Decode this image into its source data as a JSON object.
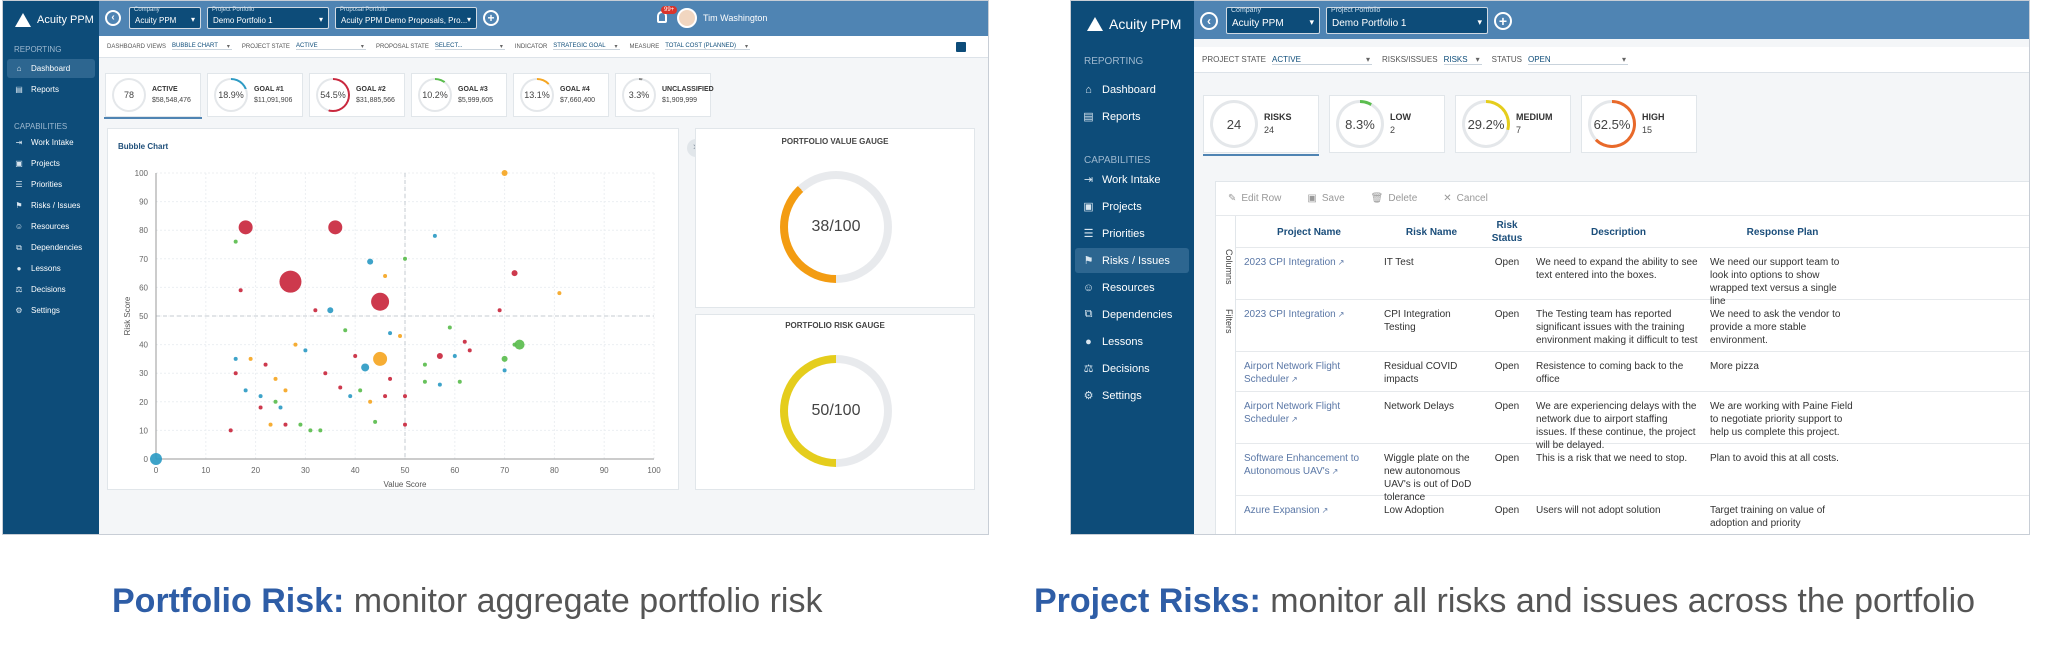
{
  "shotA": {
    "brand": "Acuity PPM",
    "company": {
      "label": "Company",
      "value": "Acuity PPM"
    },
    "project_portfolio": {
      "label": "Project Portfolio",
      "value": "Demo Portfolio 1"
    },
    "proposal_portfolio": {
      "label": "Proposal Portfolio",
      "value": "Acuity PPM Demo Proposals, Pro..."
    },
    "notif_count": "99+",
    "user": "Tim Washington",
    "nav_reporting": "REPORTING",
    "nav_capabilities": "CAPABILITIES",
    "nav": [
      {
        "label": "Dashboard",
        "icon": "home-icon"
      },
      {
        "label": "Reports",
        "icon": "report-icon"
      },
      {
        "label": "Work Intake",
        "icon": "intake-icon"
      },
      {
        "label": "Projects",
        "icon": "briefcase-icon"
      },
      {
        "label": "Priorities",
        "icon": "priorities-icon"
      },
      {
        "label": "Risks / Issues",
        "icon": "risk-icon"
      },
      {
        "label": "Resources",
        "icon": "people-icon"
      },
      {
        "label": "Dependencies",
        "icon": "dependencies-icon"
      },
      {
        "label": "Lessons",
        "icon": "lightbulb-icon"
      },
      {
        "label": "Decisions",
        "icon": "scale-icon"
      },
      {
        "label": "Settings",
        "icon": "gear-icon"
      }
    ],
    "filters": [
      {
        "label": "Dashboard Views",
        "value": "BUBBLE CHART"
      },
      {
        "label": "Project State",
        "value": "ACTIVE"
      },
      {
        "label": "Proposal State",
        "value": "SELECT..."
      },
      {
        "label": "Indicator",
        "value": "STRATEGIC GOAL"
      },
      {
        "label": "Measure",
        "value": "TOTAL COST (PLANNED)"
      }
    ],
    "kpis": [
      {
        "ring": "78",
        "label": "ACTIVE",
        "value": "$58,548,476",
        "pct": 1.0,
        "color": "#e4e7ea"
      },
      {
        "ring": "18.9%",
        "label": "GOAL #1",
        "value": "$11,091,906",
        "pct": 0.189,
        "color": "#2e9bc4"
      },
      {
        "ring": "54.5%",
        "label": "GOAL #2",
        "value": "$31,885,566",
        "pct": 0.545,
        "color": "#c9283e"
      },
      {
        "ring": "10.2%",
        "label": "GOAL #3",
        "value": "$5,999,605",
        "pct": 0.102,
        "color": "#5bbd4e"
      },
      {
        "ring": "13.1%",
        "label": "GOAL #4",
        "value": "$7,660,400",
        "pct": 0.131,
        "color": "#f5a623"
      },
      {
        "ring": "3.3%",
        "label": "UNCLASSIFIED",
        "value": "$1,909,999",
        "pct": 0.033,
        "color": "#888888"
      }
    ],
    "gauge_value": {
      "title": "PORTFOLIO VALUE GAUGE",
      "text": "38/100",
      "pct": 0.38,
      "color": "#f39c12"
    },
    "gauge_risk": {
      "title": "PORTFOLIO RISK GAUGE",
      "text": "50/100",
      "pct": 0.5,
      "color": "#e5cd1c"
    },
    "caption_bold": "Portfolio Risk:",
    "caption_rest": " monitor aggregate portfolio risk"
  },
  "chart_data": {
    "type": "scatter",
    "title": "Bubble Chart",
    "xlabel": "Value Score",
    "ylabel": "Risk Score",
    "xlim": [
      0,
      100
    ],
    "ylim": [
      0,
      100
    ],
    "xticks": [
      "0",
      "10",
      "20",
      "30",
      "40",
      "50",
      "60",
      "70",
      "80",
      "90",
      "100"
    ],
    "yticks": [
      "0",
      "10",
      "20",
      "30",
      "40",
      "50",
      "60",
      "70",
      "80",
      "90",
      "100"
    ],
    "grid": true,
    "points": [
      {
        "x": 18,
        "y": 81,
        "r": 7,
        "color": "#c9283e"
      },
      {
        "x": 36,
        "y": 81,
        "r": 7,
        "color": "#c9283e"
      },
      {
        "x": 27,
        "y": 62,
        "r": 11,
        "color": "#c9283e"
      },
      {
        "x": 45,
        "y": 55,
        "r": 9,
        "color": "#c9283e"
      },
      {
        "x": 72,
        "y": 65,
        "r": 3,
        "color": "#c9283e"
      },
      {
        "x": 70,
        "y": 100,
        "r": 3,
        "color": "#f5a623"
      },
      {
        "x": 81,
        "y": 58,
        "r": 2,
        "color": "#f5a623"
      },
      {
        "x": 16,
        "y": 76,
        "r": 2,
        "color": "#5bbd4e"
      },
      {
        "x": 17,
        "y": 59,
        "r": 2,
        "color": "#c9283e"
      },
      {
        "x": 56,
        "y": 78,
        "r": 2,
        "color": "#2e9bc4"
      },
      {
        "x": 43,
        "y": 69,
        "r": 3,
        "color": "#2e9bc4"
      },
      {
        "x": 46,
        "y": 64,
        "r": 2,
        "color": "#f5a623"
      },
      {
        "x": 50,
        "y": 70,
        "r": 2,
        "color": "#5bbd4e"
      },
      {
        "x": 35,
        "y": 52,
        "r": 3,
        "color": "#2e9bc4"
      },
      {
        "x": 32,
        "y": 52,
        "r": 2,
        "color": "#c9283e"
      },
      {
        "x": 38,
        "y": 45,
        "r": 2,
        "color": "#5bbd4e"
      },
      {
        "x": 47,
        "y": 44,
        "r": 2,
        "color": "#2e9bc4"
      },
      {
        "x": 49,
        "y": 43,
        "r": 2,
        "color": "#f5a623"
      },
      {
        "x": 59,
        "y": 46,
        "r": 2,
        "color": "#5bbd4e"
      },
      {
        "x": 62,
        "y": 41,
        "r": 2,
        "color": "#c9283e"
      },
      {
        "x": 69,
        "y": 52,
        "r": 2,
        "color": "#c9283e"
      },
      {
        "x": 72,
        "y": 40,
        "r": 2,
        "color": "#5bbd4e"
      },
      {
        "x": 73,
        "y": 40,
        "r": 5,
        "color": "#5bbd4e"
      },
      {
        "x": 45,
        "y": 35,
        "r": 7,
        "color": "#f5a623"
      },
      {
        "x": 42,
        "y": 32,
        "r": 4,
        "color": "#2e9bc4"
      },
      {
        "x": 57,
        "y": 36,
        "r": 3,
        "color": "#c9283e"
      },
      {
        "x": 54,
        "y": 33,
        "r": 2,
        "color": "#5bbd4e"
      },
      {
        "x": 60,
        "y": 36,
        "r": 2,
        "color": "#2e9bc4"
      },
      {
        "x": 63,
        "y": 38,
        "r": 2,
        "color": "#c9283e"
      },
      {
        "x": 70,
        "y": 35,
        "r": 3,
        "color": "#5bbd4e"
      },
      {
        "x": 70,
        "y": 31,
        "r": 2,
        "color": "#2e9bc4"
      },
      {
        "x": 16,
        "y": 35,
        "r": 2,
        "color": "#2e9bc4"
      },
      {
        "x": 16,
        "y": 30,
        "r": 2,
        "color": "#c9283e"
      },
      {
        "x": 18,
        "y": 24,
        "r": 2,
        "color": "#2e9bc4"
      },
      {
        "x": 21,
        "y": 22,
        "r": 2,
        "color": "#2e9bc4"
      },
      {
        "x": 22,
        "y": 33,
        "r": 2,
        "color": "#c9283e"
      },
      {
        "x": 24,
        "y": 28,
        "r": 2,
        "color": "#f5a623"
      },
      {
        "x": 24,
        "y": 20,
        "r": 2,
        "color": "#5bbd4e"
      },
      {
        "x": 26,
        "y": 24,
        "r": 2,
        "color": "#f5a623"
      },
      {
        "x": 25,
        "y": 18,
        "r": 2,
        "color": "#2e9bc4"
      },
      {
        "x": 23,
        "y": 12,
        "r": 2,
        "color": "#f5a623"
      },
      {
        "x": 26,
        "y": 12,
        "r": 2,
        "color": "#c9283e"
      },
      {
        "x": 28,
        "y": 40,
        "r": 2,
        "color": "#f5a623"
      },
      {
        "x": 30,
        "y": 38,
        "r": 2,
        "color": "#2e9bc4"
      },
      {
        "x": 29,
        "y": 12,
        "r": 2,
        "color": "#5bbd4e"
      },
      {
        "x": 31,
        "y": 10,
        "r": 2,
        "color": "#5bbd4e"
      },
      {
        "x": 33,
        "y": 10,
        "r": 2,
        "color": "#5bbd4e"
      },
      {
        "x": 34,
        "y": 30,
        "r": 2,
        "color": "#c9283e"
      },
      {
        "x": 37,
        "y": 25,
        "r": 2,
        "color": "#c9283e"
      },
      {
        "x": 39,
        "y": 22,
        "r": 2,
        "color": "#2e9bc4"
      },
      {
        "x": 41,
        "y": 24,
        "r": 2,
        "color": "#5bbd4e"
      },
      {
        "x": 43,
        "y": 20,
        "r": 2,
        "color": "#f5a623"
      },
      {
        "x": 44,
        "y": 13,
        "r": 2,
        "color": "#5bbd4e"
      },
      {
        "x": 46,
        "y": 22,
        "r": 2,
        "color": "#c9283e"
      },
      {
        "x": 50,
        "y": 22,
        "r": 2,
        "color": "#c9283e"
      },
      {
        "x": 50,
        "y": 12,
        "r": 2,
        "color": "#c9283e"
      },
      {
        "x": 54,
        "y": 27,
        "r": 2,
        "color": "#5bbd4e"
      },
      {
        "x": 57,
        "y": 26,
        "r": 2,
        "color": "#2e9bc4"
      },
      {
        "x": 61,
        "y": 27,
        "r": 2,
        "color": "#5bbd4e"
      },
      {
        "x": 47,
        "y": 28,
        "r": 2,
        "color": "#c9283e"
      },
      {
        "x": 40,
        "y": 36,
        "r": 2,
        "color": "#c9283e"
      },
      {
        "x": 19,
        "y": 35,
        "r": 2,
        "color": "#f5a623"
      },
      {
        "x": 21,
        "y": 18,
        "r": 2,
        "color": "#c9283e"
      },
      {
        "x": 15,
        "y": 10,
        "r": 2,
        "color": "#c9283e"
      },
      {
        "x": 0,
        "y": 0,
        "r": 6,
        "color": "#2e9bc4"
      }
    ]
  },
  "shotB": {
    "brand": "Acuity PPM",
    "company": {
      "label": "Company",
      "value": "Acuity PPM"
    },
    "project_portfolio": {
      "label": "Project Portfolio",
      "value": "Demo Portfolio 1"
    },
    "nav_reporting": "REPORTING",
    "nav_capabilities": "CAPABILITIES",
    "nav": [
      {
        "label": "Dashboard",
        "icon": "home-icon"
      },
      {
        "label": "Reports",
        "icon": "report-icon"
      },
      {
        "label": "Work Intake",
        "icon": "intake-icon"
      },
      {
        "label": "Projects",
        "icon": "briefcase-icon"
      },
      {
        "label": "Priorities",
        "icon": "priorities-icon"
      },
      {
        "label": "Risks / Issues",
        "icon": "risk-icon"
      },
      {
        "label": "Resources",
        "icon": "people-icon"
      },
      {
        "label": "Dependencies",
        "icon": "dependencies-icon"
      },
      {
        "label": "Lessons",
        "icon": "lightbulb-icon"
      },
      {
        "label": "Decisions",
        "icon": "scale-icon"
      },
      {
        "label": "Settings",
        "icon": "gear-icon"
      }
    ],
    "filters": [
      {
        "label": "Project State",
        "value": "ACTIVE"
      },
      {
        "label": "Risks/Issues",
        "value": "RISKS"
      },
      {
        "label": "Status",
        "value": "OPEN"
      }
    ],
    "kpis": [
      {
        "ring": "24",
        "label": "RISKS",
        "value": "24",
        "pct": 1.0,
        "color": "#e4e7ea"
      },
      {
        "ring": "8.3%",
        "label": "LOW",
        "value": "2",
        "pct": 0.083,
        "color": "#5bbd4e"
      },
      {
        "ring": "29.2%",
        "label": "MEDIUM",
        "value": "7",
        "pct": 0.292,
        "color": "#e5cd1c"
      },
      {
        "ring": "62.5%",
        "label": "HIGH",
        "value": "15",
        "pct": 0.625,
        "color": "#e8692a"
      }
    ],
    "toolbar": {
      "edit": "Edit Row",
      "save": "Save",
      "delete": "Delete",
      "cancel": "Cancel"
    },
    "side_tabs": {
      "columns": "Columns",
      "filters": "Filters"
    },
    "columns": [
      "Project Name",
      "Risk Name",
      "Risk Status",
      "Description",
      "Response Plan"
    ],
    "rows": [
      {
        "project": "2023 CPI Integration",
        "risk": "IT Test",
        "status": "Open",
        "desc": "We need to expand the ability to see text entered into the boxes.",
        "plan": "We need our support team to look into options to show wrapped text versus a single line"
      },
      {
        "project": "2023 CPI Integration",
        "risk": "CPI Integration Testing",
        "status": "Open",
        "desc": "The Testing team has reported significant issues with the training environment making it difficult to test",
        "plan": "We need to ask the vendor to provide a more stable environment."
      },
      {
        "project": "Airport Network Flight Scheduler",
        "risk": "Residual COVID impacts",
        "status": "Open",
        "desc": "Resistence to coming back to the office",
        "plan": "More pizza"
      },
      {
        "project": "Airport Network Flight Scheduler",
        "risk": "Network Delays",
        "status": "Open",
        "desc": "We are experiencing delays with the network due to airport staffing issues. If these continue, the project will be delayed.",
        "plan": "We are working with Paine Field to negotiate priority support to help us complete this project."
      },
      {
        "project": "Software Enhancement to Autonomous UAV's",
        "risk": "Wiggle plate on the new autonomous UAV's is out of DoD tolerance",
        "status": "Open",
        "desc": "This is a risk that we need to stop.",
        "plan": "Plan to avoid this at all costs."
      },
      {
        "project": "Azure Expansion",
        "risk": "Low Adoption",
        "status": "Open",
        "desc": "Users will not adopt solution",
        "plan": "Target training on value of adoption and priority"
      }
    ],
    "caption_bold": "Project Risks:",
    "caption_rest": " monitor all risks and issues across the portfolio"
  }
}
